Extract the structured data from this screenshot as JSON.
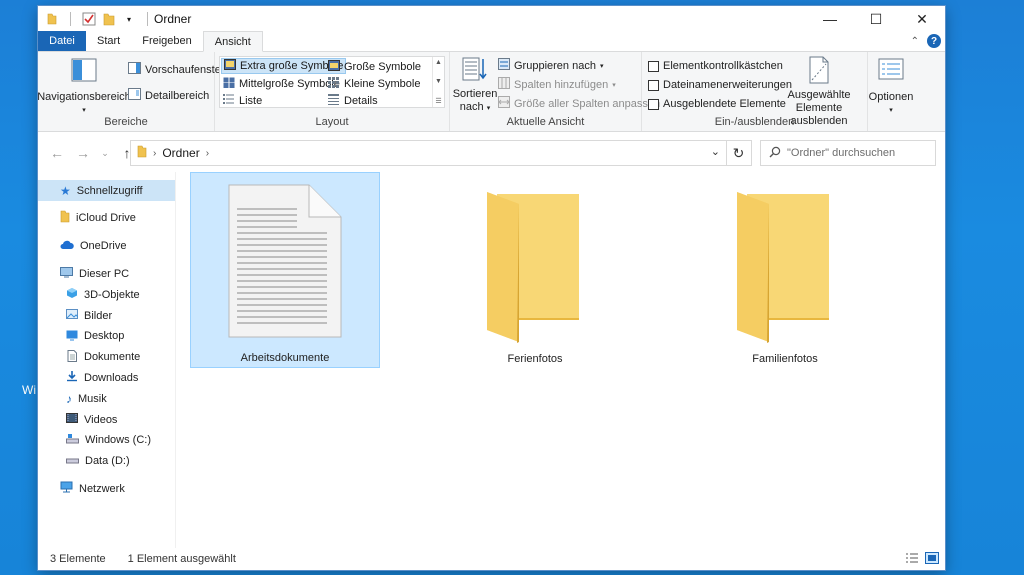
{
  "window": {
    "title": "Ordner",
    "controls": {
      "minimize": "—",
      "maximize": "☐",
      "close": "✕"
    }
  },
  "ribbon_tabs": {
    "file": "Datei",
    "items": [
      "Start",
      "Freigeben",
      "Ansicht"
    ],
    "active": "Ansicht",
    "help": "?"
  },
  "ribbon": {
    "bereiche": {
      "label": "Bereiche",
      "navigationsbereich": "Navigationsbereich",
      "vorschaufenster": "Vorschaufenster",
      "detailbereich": "Detailbereich"
    },
    "layout": {
      "label": "Layout",
      "items": [
        "Extra große Symbole",
        "Große Symbole",
        "Mittelgroße Symbole",
        "Kleine Symbole",
        "Liste",
        "Details"
      ],
      "selected": "Extra große Symbole"
    },
    "aktuelle_ansicht": {
      "label": "Aktuelle Ansicht",
      "sortieren": "Sortieren",
      "nach": "nach",
      "gruppieren": "Gruppieren nach",
      "spalten": "Spalten hinzufügen",
      "groesse": "Größe aller Spalten anpassen"
    },
    "ein_ausblenden": {
      "label": "Ein-/ausblenden",
      "elementkontrollkaestchen": "Elementkontrollkästchen",
      "dateinamenerweiterungen": "Dateinamenerweiterungen",
      "ausgeblendete": "Ausgeblendete Elemente",
      "ausgewaehlte_1": "Ausgewählte",
      "ausgewaehlte_2": "Elemente ausblenden"
    },
    "optionen": "Optionen"
  },
  "address": {
    "path": "Ordner",
    "search_placeholder": "\"Ordner\" durchsuchen"
  },
  "sidebar": {
    "schnellzugriff": "Schnellzugriff",
    "icloud": "iCloud Drive",
    "onedrive": "OneDrive",
    "dieser_pc": "Dieser PC",
    "pc_items": [
      "3D-Objekte",
      "Bilder",
      "Desktop",
      "Dokumente",
      "Downloads",
      "Musik",
      "Videos",
      "Windows (C:)",
      "Data (D:)"
    ],
    "netzwerk": "Netzwerk"
  },
  "files": [
    {
      "name": "Arbeitsdokumente",
      "type": "document",
      "selected": true
    },
    {
      "name": "Ferienfotos",
      "type": "folder",
      "selected": false
    },
    {
      "name": "Familienfotos",
      "type": "folder",
      "selected": false
    }
  ],
  "status": {
    "count": "3 Elemente",
    "selection": "1 Element ausgewählt"
  },
  "desktop_text": "Wi",
  "colors": {
    "accent": "#1a66b6",
    "selection": "#cce8ff",
    "folder": "#f8d775"
  }
}
